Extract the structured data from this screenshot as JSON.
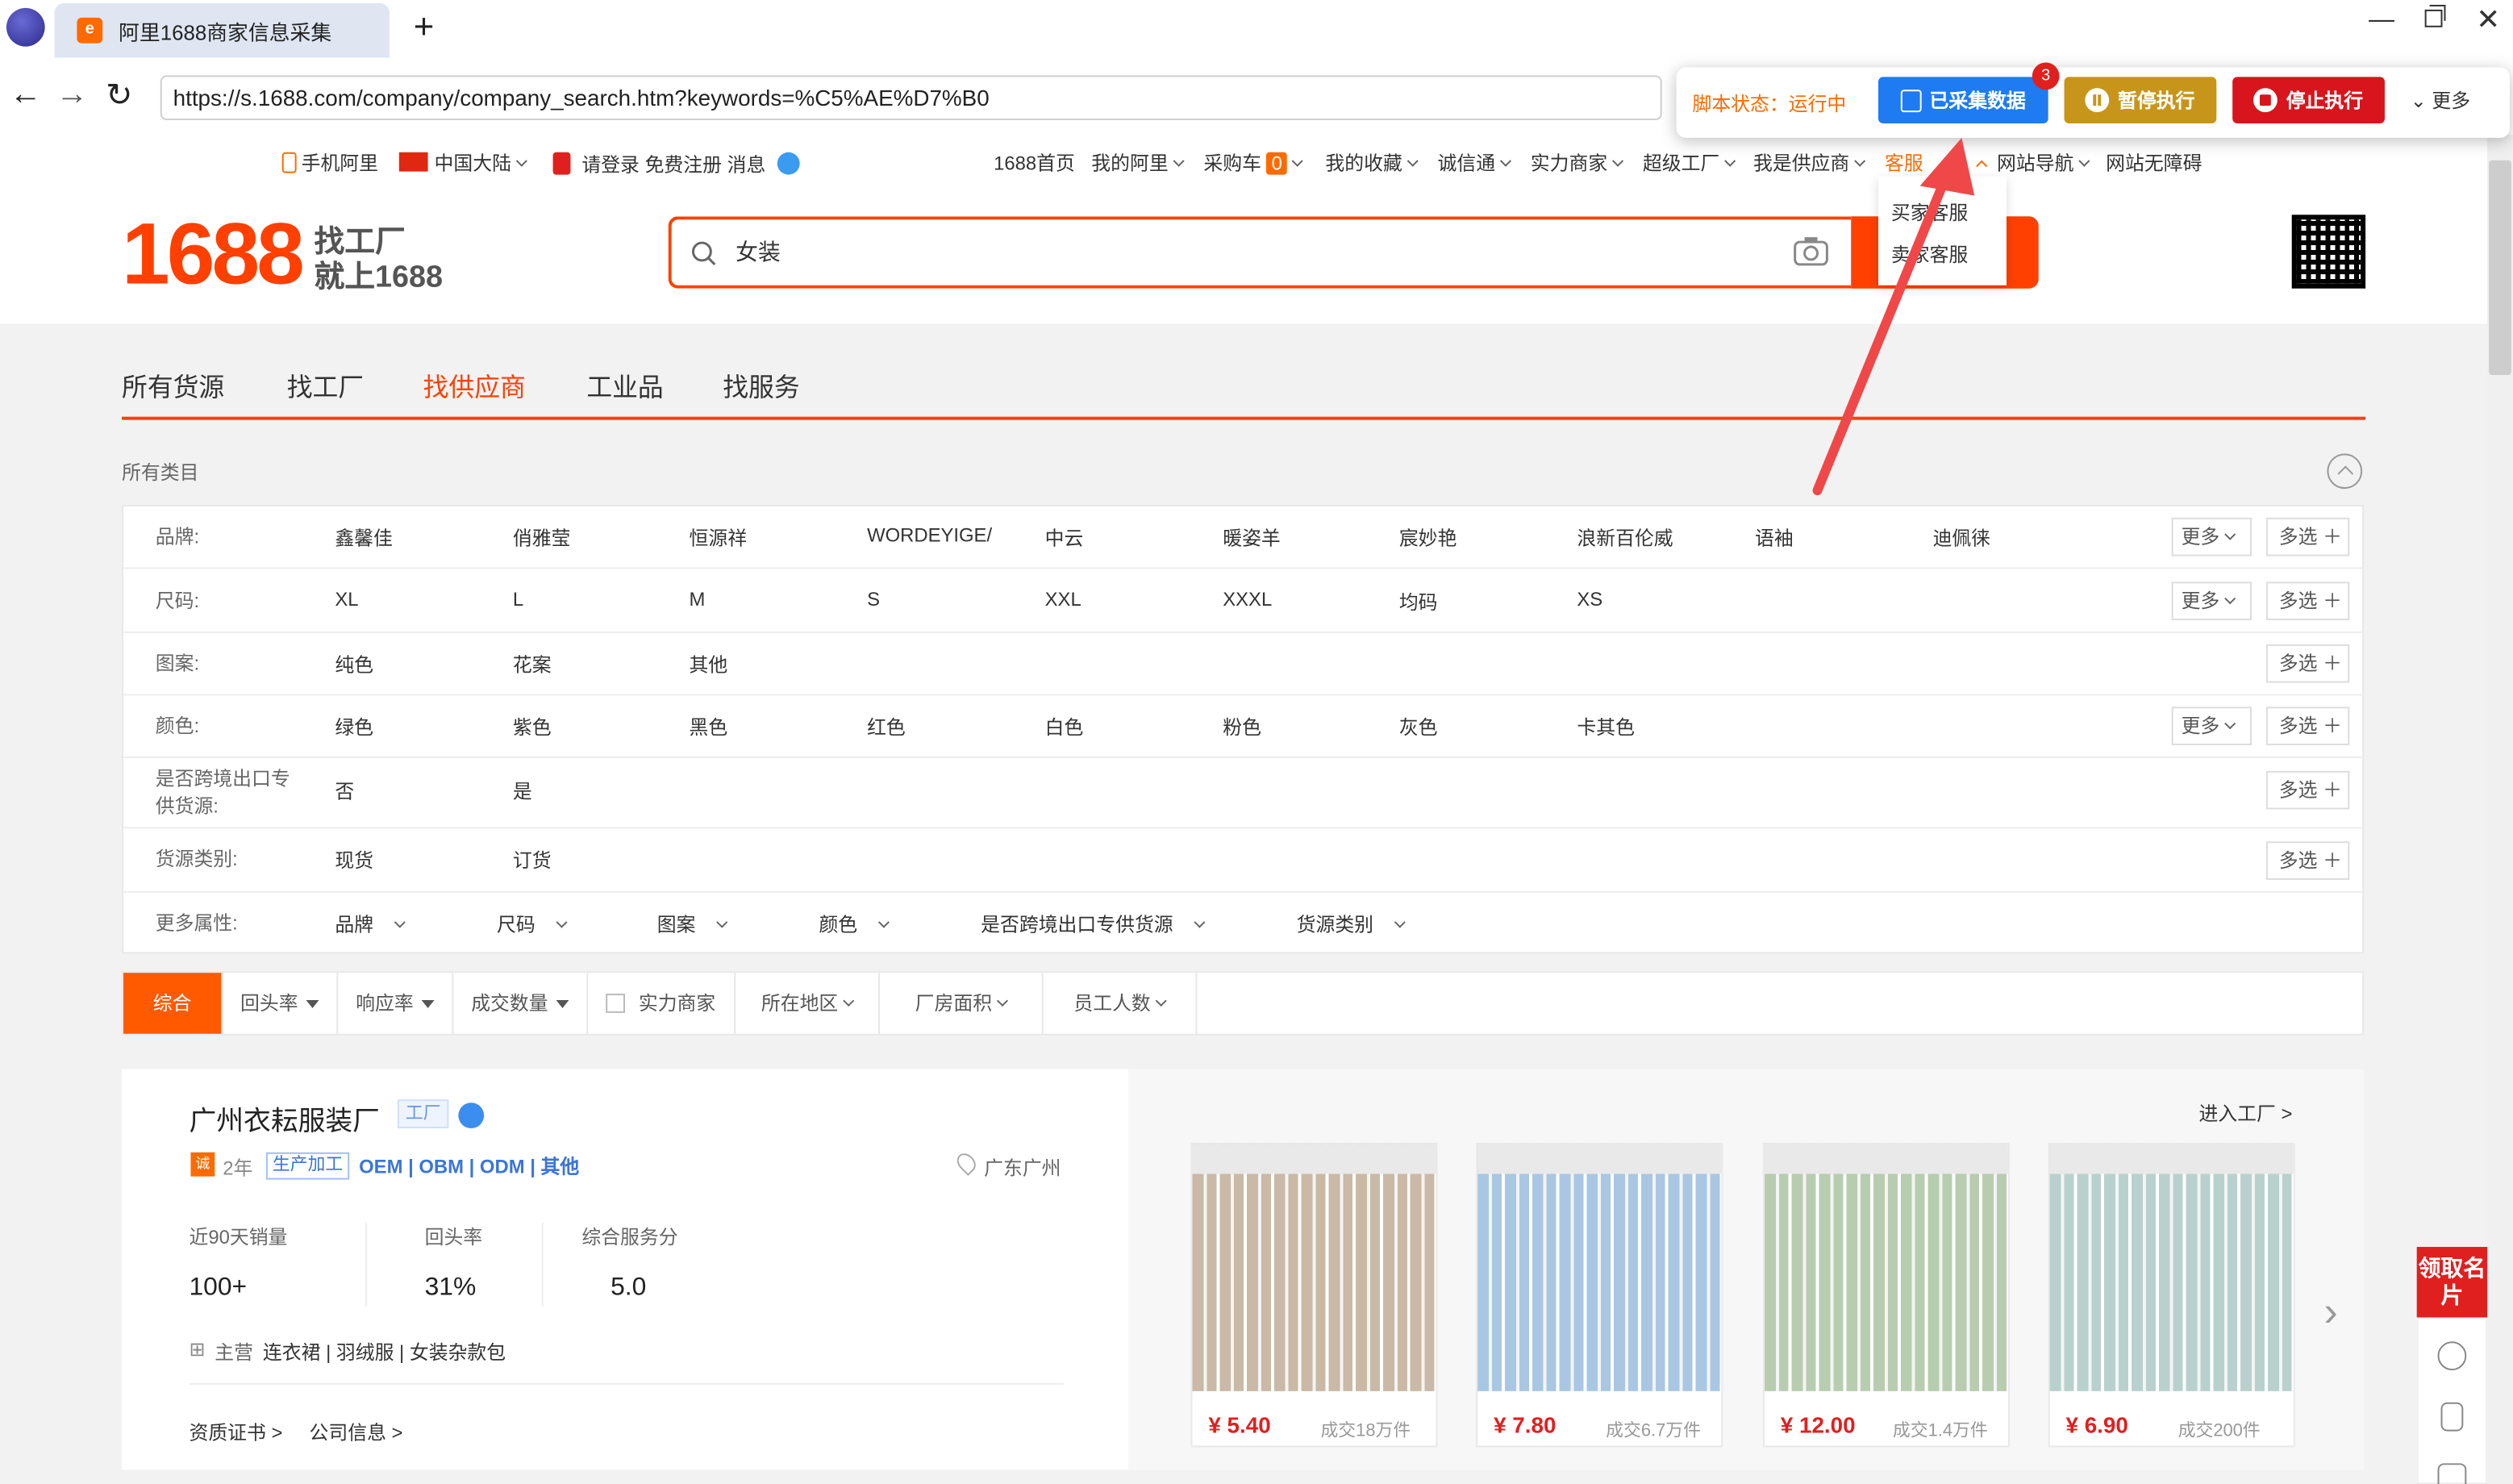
{
  "browser": {
    "tab_title": "阿里1688商家信息采集",
    "tab_favicon": "e",
    "new_tab": "+",
    "url": "https://s.1688.com/company/company_search.htm?keywords=%C5%AE%D7%B0"
  },
  "script_panel": {
    "status": "脚本状态：运行中",
    "collected_label": "已采集数据",
    "collected_count": "3",
    "pause_label": "暂停执行",
    "stop_label": "停止执行",
    "more_label": "更多"
  },
  "topbar": {
    "mobile": "手机阿里",
    "region": "中国大陆",
    "login": "请登录",
    "register": "免费注册",
    "message": "消息",
    "links": [
      "1688首页",
      "我的阿里",
      "采购车",
      "我的收藏",
      "诚信通",
      "实力商家",
      "超级工厂",
      "我是供应商",
      "客服",
      "网站导航",
      "网站无障碍"
    ],
    "cart_count": "0",
    "cs_items": [
      "买家客服",
      "卖家客服"
    ]
  },
  "header": {
    "logo_num": "1688",
    "slogan1": "找工厂",
    "slogan2": "就上1688",
    "search_value": "女装"
  },
  "category_tabs": [
    "所有货源",
    "找工厂",
    "找供应商",
    "工业品",
    "找服务"
  ],
  "active_tab_index": 2,
  "all_categories": "所有类目",
  "filters": [
    {
      "label": "品牌:",
      "values": [
        "鑫馨佳",
        "俏雅莹",
        "恒源祥",
        "WORDEYIGE/",
        "中云",
        "暖姿羊",
        "宸妙艳",
        "浪新百伦威",
        "语袖",
        "迪佩徕"
      ],
      "more": true
    },
    {
      "label": "尺码:",
      "values": [
        "XL",
        "L",
        "M",
        "S",
        "XXL",
        "XXXL",
        "均码",
        "XS"
      ],
      "more": true
    },
    {
      "label": "图案:",
      "values": [
        "纯色",
        "花案",
        "其他"
      ],
      "more": false
    },
    {
      "label": "颜色:",
      "values": [
        "绿色",
        "紫色",
        "黑色",
        "红色",
        "白色",
        "粉色",
        "灰色",
        "卡其色"
      ],
      "more": true
    },
    {
      "label": "是否跨境出口专供货源:",
      "values": [
        "否",
        "是"
      ],
      "more": false
    },
    {
      "label": "货源类别:",
      "values": [
        "现货",
        "订货"
      ],
      "more": false
    }
  ],
  "more_attrs": {
    "label": "更多属性:",
    "values": [
      "品牌",
      "尺码",
      "图案",
      "颜色",
      "是否跨境出口专供货源",
      "货源类别"
    ]
  },
  "filter_buttons": {
    "more": "更多",
    "multi": "多选"
  },
  "sort_bar": {
    "default": "综合",
    "items": [
      "回头率",
      "响应率",
      "成交数量"
    ],
    "checkbox": "实力商家",
    "dropdowns": [
      "所在地区",
      "厂房面积",
      "员工人数"
    ]
  },
  "company": {
    "name": "广州衣耘服装厂",
    "tag": "工厂",
    "years_icon": "诚",
    "years": "2年",
    "prod_tag": "生产加工",
    "modes": "OEM | OBM | ODM | 其他",
    "location": "广东广州",
    "stats": [
      {
        "label": "近90天销量",
        "value": "100+"
      },
      {
        "label": "回头率",
        "value": "31%"
      },
      {
        "label": "综合服务分",
        "value": "5.0"
      }
    ],
    "main_label": "主营",
    "main_products": "连衣裙 | 羽绒服 | 女装杂款包",
    "cert_link": "资质证书 >",
    "info_link": "公司信息 >",
    "enter_factory": "进入工厂 >"
  },
  "products": [
    {
      "price": "¥ 5.40",
      "sold": "成交18万件",
      "tone": "#c9b9a6"
    },
    {
      "price": "¥ 7.80",
      "sold": "成交6.7万件",
      "tone": "#a9c7e3"
    },
    {
      "price": "¥ 12.00",
      "sold": "成交1.4万件",
      "tone": "#b8cdb0"
    },
    {
      "price": "¥ 6.90",
      "sold": "成交200件",
      "tone": "#b9d1cc"
    }
  ],
  "side": {
    "card_label": "领取名片"
  }
}
